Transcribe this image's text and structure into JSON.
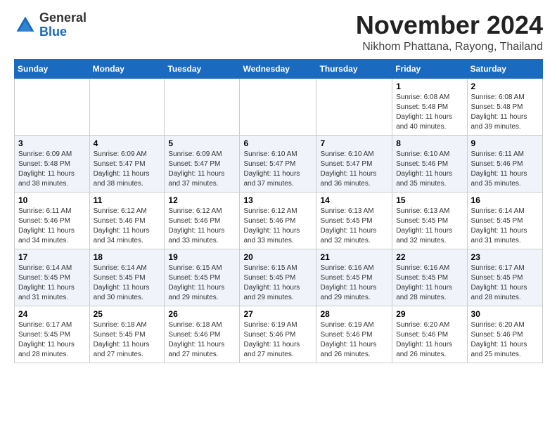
{
  "logo": {
    "general": "General",
    "blue": "Blue"
  },
  "title": "November 2024",
  "subtitle": "Nikhom Phattana, Rayong, Thailand",
  "days_header": [
    "Sunday",
    "Monday",
    "Tuesday",
    "Wednesday",
    "Thursday",
    "Friday",
    "Saturday"
  ],
  "weeks": [
    [
      {
        "day": "",
        "info": ""
      },
      {
        "day": "",
        "info": ""
      },
      {
        "day": "",
        "info": ""
      },
      {
        "day": "",
        "info": ""
      },
      {
        "day": "",
        "info": ""
      },
      {
        "day": "1",
        "info": "Sunrise: 6:08 AM\nSunset: 5:48 PM\nDaylight: 11 hours and 40 minutes."
      },
      {
        "day": "2",
        "info": "Sunrise: 6:08 AM\nSunset: 5:48 PM\nDaylight: 11 hours and 39 minutes."
      }
    ],
    [
      {
        "day": "3",
        "info": "Sunrise: 6:09 AM\nSunset: 5:48 PM\nDaylight: 11 hours and 38 minutes."
      },
      {
        "day": "4",
        "info": "Sunrise: 6:09 AM\nSunset: 5:47 PM\nDaylight: 11 hours and 38 minutes."
      },
      {
        "day": "5",
        "info": "Sunrise: 6:09 AM\nSunset: 5:47 PM\nDaylight: 11 hours and 37 minutes."
      },
      {
        "day": "6",
        "info": "Sunrise: 6:10 AM\nSunset: 5:47 PM\nDaylight: 11 hours and 37 minutes."
      },
      {
        "day": "7",
        "info": "Sunrise: 6:10 AM\nSunset: 5:47 PM\nDaylight: 11 hours and 36 minutes."
      },
      {
        "day": "8",
        "info": "Sunrise: 6:10 AM\nSunset: 5:46 PM\nDaylight: 11 hours and 35 minutes."
      },
      {
        "day": "9",
        "info": "Sunrise: 6:11 AM\nSunset: 5:46 PM\nDaylight: 11 hours and 35 minutes."
      }
    ],
    [
      {
        "day": "10",
        "info": "Sunrise: 6:11 AM\nSunset: 5:46 PM\nDaylight: 11 hours and 34 minutes."
      },
      {
        "day": "11",
        "info": "Sunrise: 6:12 AM\nSunset: 5:46 PM\nDaylight: 11 hours and 34 minutes."
      },
      {
        "day": "12",
        "info": "Sunrise: 6:12 AM\nSunset: 5:46 PM\nDaylight: 11 hours and 33 minutes."
      },
      {
        "day": "13",
        "info": "Sunrise: 6:12 AM\nSunset: 5:46 PM\nDaylight: 11 hours and 33 minutes."
      },
      {
        "day": "14",
        "info": "Sunrise: 6:13 AM\nSunset: 5:45 PM\nDaylight: 11 hours and 32 minutes."
      },
      {
        "day": "15",
        "info": "Sunrise: 6:13 AM\nSunset: 5:45 PM\nDaylight: 11 hours and 32 minutes."
      },
      {
        "day": "16",
        "info": "Sunrise: 6:14 AM\nSunset: 5:45 PM\nDaylight: 11 hours and 31 minutes."
      }
    ],
    [
      {
        "day": "17",
        "info": "Sunrise: 6:14 AM\nSunset: 5:45 PM\nDaylight: 11 hours and 31 minutes."
      },
      {
        "day": "18",
        "info": "Sunrise: 6:14 AM\nSunset: 5:45 PM\nDaylight: 11 hours and 30 minutes."
      },
      {
        "day": "19",
        "info": "Sunrise: 6:15 AM\nSunset: 5:45 PM\nDaylight: 11 hours and 29 minutes."
      },
      {
        "day": "20",
        "info": "Sunrise: 6:15 AM\nSunset: 5:45 PM\nDaylight: 11 hours and 29 minutes."
      },
      {
        "day": "21",
        "info": "Sunrise: 6:16 AM\nSunset: 5:45 PM\nDaylight: 11 hours and 29 minutes."
      },
      {
        "day": "22",
        "info": "Sunrise: 6:16 AM\nSunset: 5:45 PM\nDaylight: 11 hours and 28 minutes."
      },
      {
        "day": "23",
        "info": "Sunrise: 6:17 AM\nSunset: 5:45 PM\nDaylight: 11 hours and 28 minutes."
      }
    ],
    [
      {
        "day": "24",
        "info": "Sunrise: 6:17 AM\nSunset: 5:45 PM\nDaylight: 11 hours and 28 minutes."
      },
      {
        "day": "25",
        "info": "Sunrise: 6:18 AM\nSunset: 5:45 PM\nDaylight: 11 hours and 27 minutes."
      },
      {
        "day": "26",
        "info": "Sunrise: 6:18 AM\nSunset: 5:46 PM\nDaylight: 11 hours and 27 minutes."
      },
      {
        "day": "27",
        "info": "Sunrise: 6:19 AM\nSunset: 5:46 PM\nDaylight: 11 hours and 27 minutes."
      },
      {
        "day": "28",
        "info": "Sunrise: 6:19 AM\nSunset: 5:46 PM\nDaylight: 11 hours and 26 minutes."
      },
      {
        "day": "29",
        "info": "Sunrise: 6:20 AM\nSunset: 5:46 PM\nDaylight: 11 hours and 26 minutes."
      },
      {
        "day": "30",
        "info": "Sunrise: 6:20 AM\nSunset: 5:46 PM\nDaylight: 11 hours and 25 minutes."
      }
    ]
  ]
}
